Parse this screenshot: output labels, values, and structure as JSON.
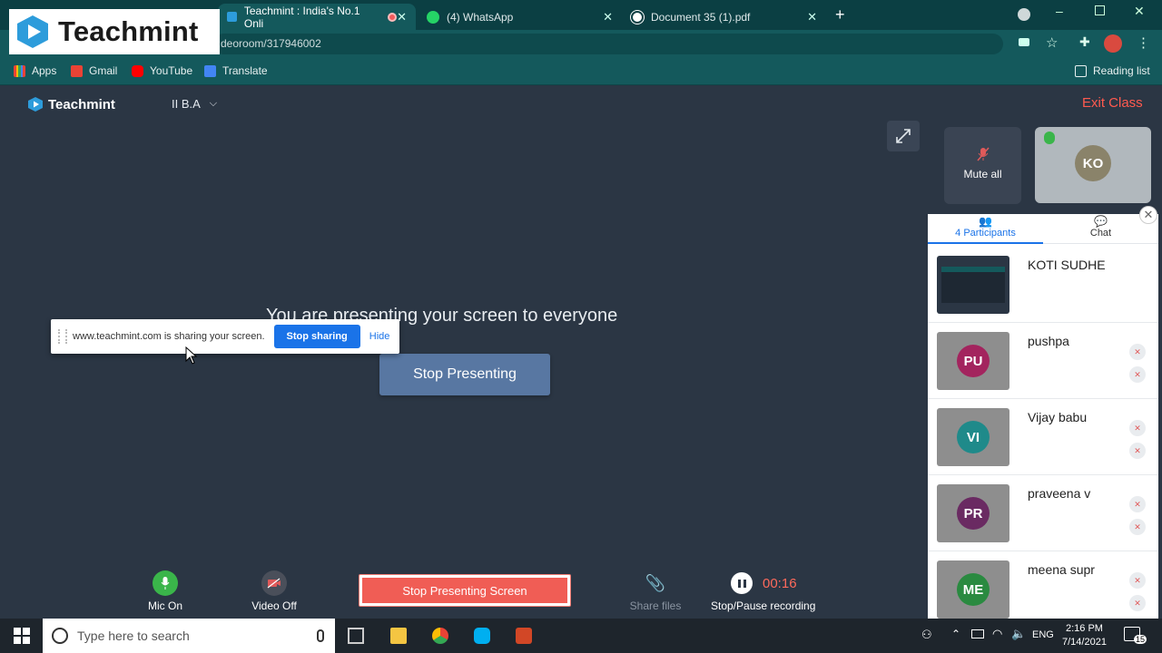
{
  "browser": {
    "tabs": [
      {
        "label": "Teachmint : India's No.1 Onli",
        "active": true
      },
      {
        "label": "(4) WhatsApp",
        "active": false
      },
      {
        "label": "Document 35 (1).pdf",
        "active": false
      }
    ],
    "url": "deoroom/317946002",
    "bookmarks": [
      "Apps",
      "Gmail",
      "YouTube",
      "Translate"
    ],
    "reading_list": "Reading list"
  },
  "logo_overlay": {
    "text": "Teachmint"
  },
  "app": {
    "brand": "Teachmint",
    "class_name": "II B.A",
    "exit": "Exit Class",
    "mute_all": "Mute all",
    "self_tile_initials": "KO",
    "presenting_message": "You are presenting your screen to everyone",
    "stop_presenting": "Stop Presenting"
  },
  "share_notice": {
    "message": "www.teachmint.com is sharing your screen.",
    "stop_label": "Stop sharing",
    "hide_label": "Hide"
  },
  "panel": {
    "participants_tab": "4 Participants",
    "chat_tab": "Chat",
    "participants": [
      {
        "name": "KOTI SUDHE",
        "initials": "",
        "color": "#2b3644"
      },
      {
        "name": "pushpa",
        "initials": "PU",
        "color": "#a3245e"
      },
      {
        "name": "Vijay babu",
        "initials": "VI",
        "color": "#1f8a8a"
      },
      {
        "name": "praveena v",
        "initials": "PR",
        "color": "#6a2a62"
      },
      {
        "name": "meena supr",
        "initials": "ME",
        "color": "#2a8a40"
      }
    ]
  },
  "controls": {
    "mic": "Mic On",
    "video": "Video Off",
    "stop_screen": "Stop Presenting Screen",
    "share_files": "Share files",
    "recording": "Stop/Pause recording",
    "recording_time": "00:16"
  },
  "taskbar": {
    "search_placeholder": "Type here to search",
    "language": "ENG",
    "time": "2:16 PM",
    "date": "7/14/2021",
    "notifications": "15"
  },
  "colors": {
    "brand_teal": "#14595c",
    "accent_blue": "#1a73e8",
    "danger": "#f05d55"
  }
}
